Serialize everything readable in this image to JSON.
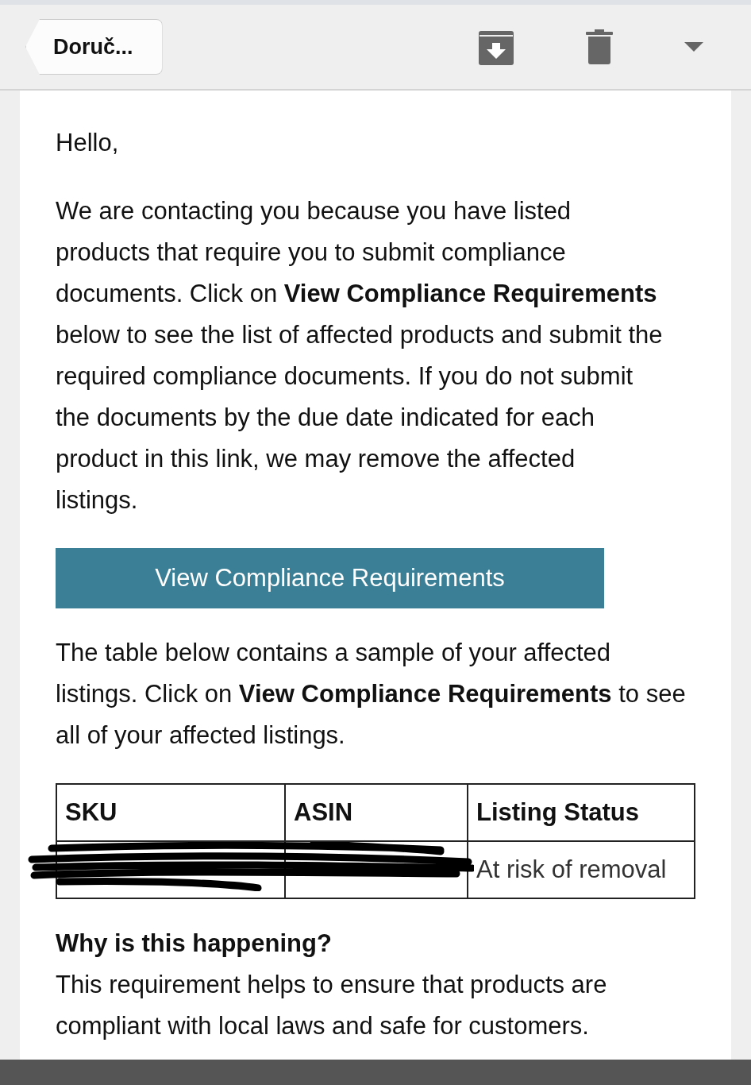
{
  "toolbar": {
    "back_label": "Doruč..."
  },
  "email": {
    "greeting": "Hello,",
    "intro": "We are contacting you because you have listed products that require you to submit compliance documents. Click on **View Compliance Requirements** below to see the list of affected products and submit the required compliance documents. If you do not submit the documents by the due date indicated for each product in this link, we may remove the affected listings.",
    "button": "View Compliance Requirements",
    "table_intro": "The table below contains a sample of your affected listings. Click on **View Compliance Requirements** to see all of your affected listings.",
    "table": {
      "columns": [
        "SKU",
        "ASIN",
        "Listing Status"
      ],
      "rows": [
        {
          "status": "At risk of removal",
          "redacted": true
        }
      ]
    },
    "section_title": "Why is this happening?",
    "section_text": "This requirement helps to ensure that products are compliant with local laws and safe for customers."
  }
}
